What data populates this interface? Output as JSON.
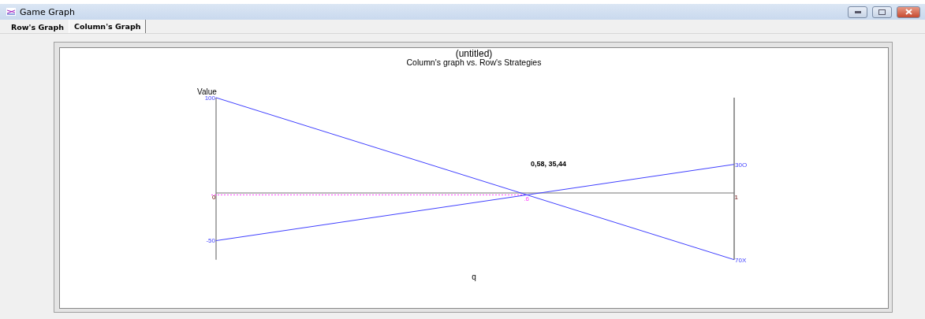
{
  "window": {
    "title": "Game Graph"
  },
  "tabs": [
    {
      "label": "Row's Graph",
      "selected": false
    },
    {
      "label": "Column's Graph",
      "selected": true
    }
  ],
  "chart": {
    "title": "(untitled)",
    "subtitle": "Column's graph vs. Row's Strategies",
    "chart_data": {
      "type": "line",
      "xlabel": "q",
      "ylabel": "Value",
      "x": [
        0,
        1
      ],
      "xlim": [
        0,
        1
      ],
      "ylim": [
        -70,
        100
      ],
      "xticks": [
        0,
        1
      ],
      "yticks": [
        {
          "value": 100,
          "label": "100"
        },
        {
          "value": -50,
          "label": "-50"
        }
      ],
      "series": [
        {
          "name": "30O",
          "color": "#4040ff",
          "values": [
            -50,
            30
          ]
        },
        {
          "name": "70X",
          "color": "#4040ff",
          "values": [
            100,
            -70
          ]
        }
      ],
      "annotations": [
        {
          "x": 0.6,
          "y": -2,
          "text": ".6"
        }
      ]
    },
    "readout": "0,58, 35,44"
  }
}
